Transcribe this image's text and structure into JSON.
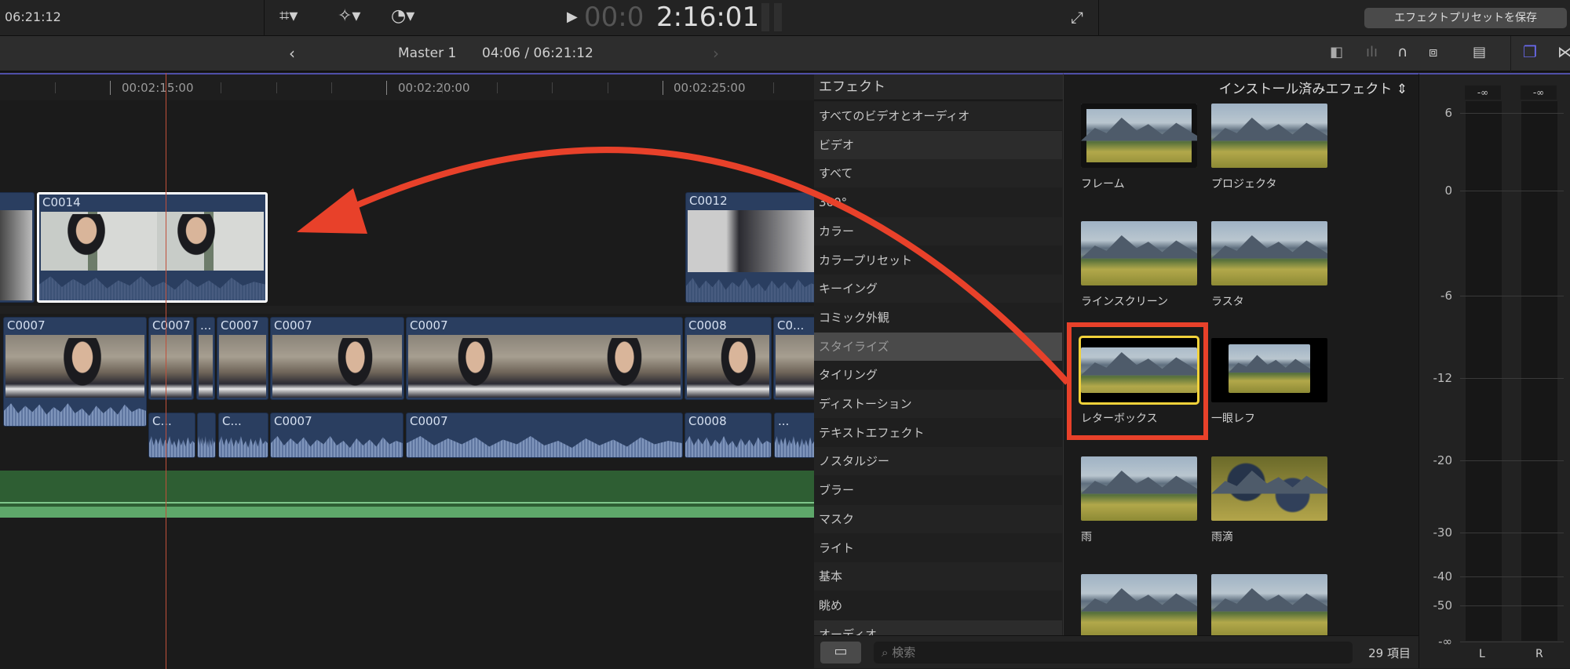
{
  "topbar": {
    "duration": "06:21:12",
    "timecode_dim": "00:0",
    "timecode_bright": "2:16:01",
    "save_preset": "エフェクトプリセットを保存"
  },
  "navbar": {
    "project": "Master 1",
    "position": "04:06 / 06:21:12"
  },
  "ruler": [
    "00:02:15:00",
    "00:02:20:00",
    "00:02:25:00"
  ],
  "timeline": {
    "connected": [
      "C0014",
      "C0012"
    ],
    "primary": [
      "C0007",
      "C0007",
      "...",
      "C0007",
      "C0007",
      "C0007",
      "C0008",
      "C0..."
    ],
    "audio": [
      "C...",
      "",
      "C...",
      "C0007",
      "C0007",
      "C0008",
      "..."
    ]
  },
  "effects_list": {
    "header": "エフェクト",
    "items": [
      "すべてのビデオとオーディオ",
      "ビデオ",
      "すべて",
      "360°",
      "カラー",
      "カラープリセット",
      "キーイング",
      "コミック外観",
      "スタイライズ",
      "タイリング",
      "ディストーション",
      "テキストエフェクト",
      "ノスタルジー",
      "ブラー",
      "マスク",
      "ライト",
      "基本",
      "眺め",
      "オーディオ"
    ],
    "selected": "スタイライズ"
  },
  "effects_grid": {
    "header": "インストール済みエフェクト",
    "items": [
      "フレーム",
      "プロジェクタ",
      "ラインスクリーン",
      "ラスタ",
      "レターボックス",
      "一眼レフ",
      "雨",
      "雨滴",
      "",
      ""
    ],
    "highlighted": "レターボックス"
  },
  "bottom": {
    "search_placeholder": "検索",
    "count": "29 項目"
  },
  "meters": {
    "peaks": [
      "-∞",
      "-∞"
    ],
    "scale": [
      "6",
      "0",
      "-6",
      "-12",
      "-20",
      "-30",
      "-40",
      "-50",
      "-∞"
    ],
    "channels": [
      "L",
      "R"
    ]
  },
  "colors": {
    "accent": "#5b5bd6",
    "annotation": "#e8412a",
    "clip": "#2a3e60",
    "audio_track": "#2e5e33"
  }
}
